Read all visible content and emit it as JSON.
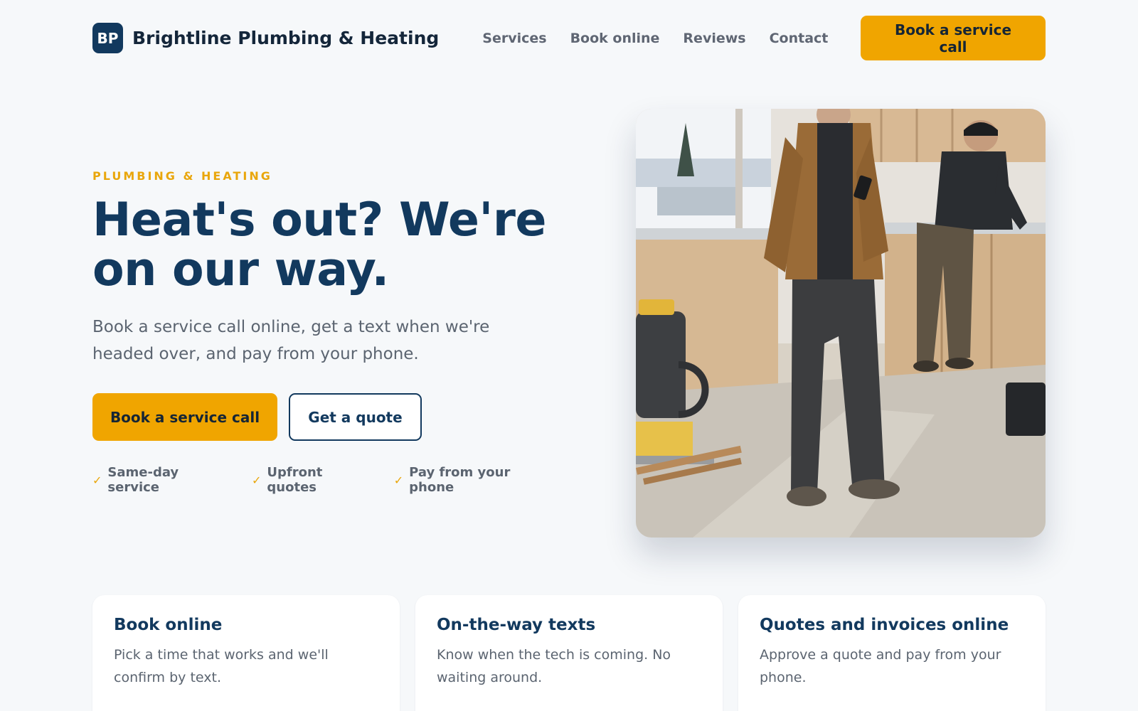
{
  "header": {
    "logo_initials": "BP",
    "brand_name": "Brightline Plumbing & Heating",
    "nav": [
      {
        "label": "Services"
      },
      {
        "label": "Book online"
      },
      {
        "label": "Reviews"
      },
      {
        "label": "Contact"
      }
    ],
    "cta_label": "Book a service call"
  },
  "hero": {
    "eyebrow": "PLUMBING & HEATING",
    "headline_line1": "Heat's out? We're",
    "headline_line2": "on our way.",
    "subhead": "Book a service call online, get a text when we're headed over, and pay from your phone.",
    "primary_cta": "Book a service call",
    "secondary_cta": "Get a quote",
    "perks": [
      {
        "icon": "check-icon",
        "label": "Same-day service"
      },
      {
        "icon": "check-icon",
        "label": "Upfront quotes"
      },
      {
        "icon": "check-icon",
        "label": "Pay from your phone"
      }
    ],
    "image_description": "Two contractors working in a kitchen under renovation, one checking a phone"
  },
  "features": [
    {
      "title": "Book online",
      "body": "Pick a time that works and we'll confirm by text."
    },
    {
      "title": "On-the-way texts",
      "body": "Know when the tech is coming. No waiting around."
    },
    {
      "title": "Quotes and invoices online",
      "body": "Approve a quote and pay from your phone."
    }
  ],
  "colors": {
    "brand_navy": "#12395e",
    "accent_amber": "#f0a500",
    "background": "#f6f8fa",
    "muted_text": "#5b6470"
  }
}
